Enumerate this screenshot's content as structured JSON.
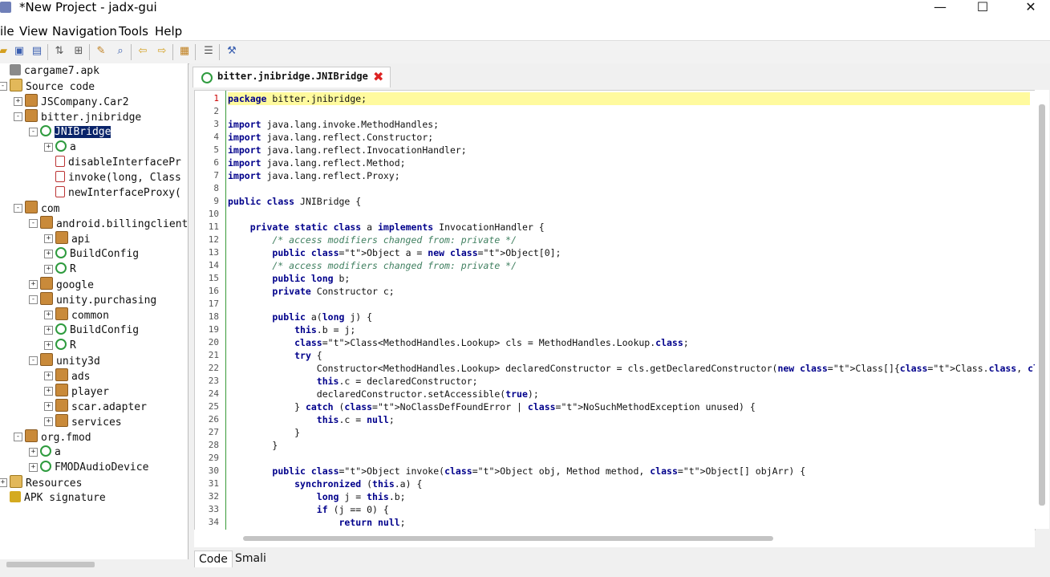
{
  "window": {
    "title": "*New Project - jadx-gui",
    "minimize": "—",
    "maximize": "☐",
    "close": "✕"
  },
  "menu": [
    "ile",
    "View",
    "Navigation",
    "Tools",
    "Help"
  ],
  "tree": [
    {
      "label": "cargame7.apk",
      "indent": 0,
      "icon": "apk"
    },
    {
      "label": "Source code",
      "indent": 0,
      "icon": "folder",
      "exp": "-"
    },
    {
      "label": "JSCompany.Car2",
      "indent": 1,
      "icon": "pkg",
      "exp": "+"
    },
    {
      "label": "bitter.jnibridge",
      "indent": 1,
      "icon": "pkg",
      "exp": "-"
    },
    {
      "label": "JNIBridge",
      "indent": 2,
      "icon": "cls",
      "exp": "-",
      "selected": true
    },
    {
      "label": "a",
      "indent": 3,
      "icon": "cls",
      "exp": "+"
    },
    {
      "label": "disableInterfacePr",
      "indent": 3,
      "icon": "meth"
    },
    {
      "label": "invoke(long, Class",
      "indent": 3,
      "icon": "meth"
    },
    {
      "label": "newInterfaceProxy(",
      "indent": 3,
      "icon": "meth"
    },
    {
      "label": "com",
      "indent": 1,
      "icon": "pkg",
      "exp": "-"
    },
    {
      "label": "android.billingclient",
      "indent": 2,
      "icon": "pkg",
      "exp": "-"
    },
    {
      "label": "api",
      "indent": 3,
      "icon": "pkg",
      "exp": "+"
    },
    {
      "label": "BuildConfig",
      "indent": 3,
      "icon": "cls",
      "exp": "+"
    },
    {
      "label": "R",
      "indent": 3,
      "icon": "cls",
      "exp": "+"
    },
    {
      "label": "google",
      "indent": 2,
      "icon": "pkg",
      "exp": "+"
    },
    {
      "label": "unity.purchasing",
      "indent": 2,
      "icon": "pkg",
      "exp": "-"
    },
    {
      "label": "common",
      "indent": 3,
      "icon": "pkg",
      "exp": "+"
    },
    {
      "label": "BuildConfig",
      "indent": 3,
      "icon": "cls",
      "exp": "+"
    },
    {
      "label": "R",
      "indent": 3,
      "icon": "cls",
      "exp": "+"
    },
    {
      "label": "unity3d",
      "indent": 2,
      "icon": "pkg",
      "exp": "-"
    },
    {
      "label": "ads",
      "indent": 3,
      "icon": "pkg",
      "exp": "+"
    },
    {
      "label": "player",
      "indent": 3,
      "icon": "pkg",
      "exp": "+"
    },
    {
      "label": "scar.adapter",
      "indent": 3,
      "icon": "pkg",
      "exp": "+"
    },
    {
      "label": "services",
      "indent": 3,
      "icon": "pkg",
      "exp": "+"
    },
    {
      "label": "org.fmod",
      "indent": 1,
      "icon": "pkg",
      "exp": "-"
    },
    {
      "label": "a",
      "indent": 2,
      "icon": "cls",
      "exp": "+"
    },
    {
      "label": "FMODAudioDevice",
      "indent": 2,
      "icon": "cls",
      "exp": "+"
    },
    {
      "label": "Resources",
      "indent": 0,
      "icon": "folder",
      "exp": "+"
    },
    {
      "label": "APK signature",
      "indent": 0,
      "icon": "key"
    }
  ],
  "tab": {
    "label": "bitter.jnibridge.JNIBridge",
    "close": "✖"
  },
  "code": [
    "package bitter.jnibridge;",
    "",
    "import java.lang.invoke.MethodHandles;",
    "import java.lang.reflect.Constructor;",
    "import java.lang.reflect.InvocationHandler;",
    "import java.lang.reflect.Method;",
    "import java.lang.reflect.Proxy;",
    "",
    "public class JNIBridge {",
    "",
    "    private static class a implements InvocationHandler {",
    "        /* access modifiers changed from: private */",
    "        public Object a = new Object[0];",
    "        /* access modifiers changed from: private */",
    "        public long b;",
    "        private Constructor c;",
    "",
    "        public a(long j) {",
    "            this.b = j;",
    "            Class<MethodHandles.Lookup> cls = MethodHandles.Lookup.class;",
    "            try {",
    "                Constructor<MethodHandles.Lookup> declaredConstructor = cls.getDeclaredConstructor(new Class[]{Class.class, Integer.TYPE});",
    "                this.c = declaredConstructor;",
    "                declaredConstructor.setAccessible(true);",
    "            } catch (NoClassDefFoundError | NoSuchMethodException unused) {",
    "                this.c = null;",
    "            }",
    "        }",
    "",
    "        public Object invoke(Object obj, Method method, Object[] objArr) {",
    "            synchronized (this.a) {",
    "                long j = this.b;",
    "                if (j == 0) {",
    "                    return null;"
  ],
  "bottom_tabs": [
    "Code",
    "Smali"
  ]
}
